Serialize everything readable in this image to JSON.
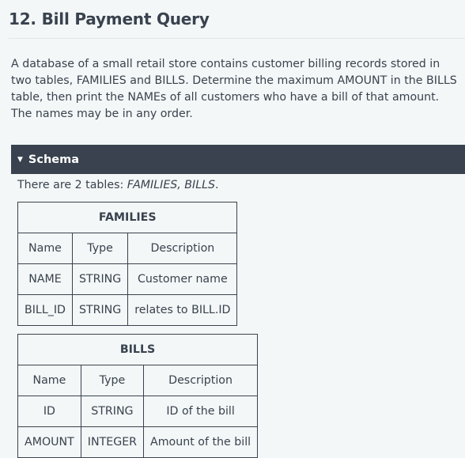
{
  "page": {
    "title": "12. Bill Payment Query",
    "description": "A database of a small retail store contains customer billing records stored in two tables, FAMILIES and BILLS. Determine the maximum AMOUNT in the BILLS table, then print the NAMEs of all customers who have a bill of that amount. The names may be in any order."
  },
  "schema": {
    "toggle_icon": "triangle-down-icon",
    "label": "Schema",
    "intro_prefix": "There are 2 tables: ",
    "intro_tables": "FAMILIES, BILLS",
    "intro_suffix": ".",
    "tables": [
      {
        "name": "FAMILIES",
        "headers": [
          "Name",
          "Type",
          "Description"
        ],
        "rows": [
          [
            "NAME",
            "STRING",
            "Customer name"
          ],
          [
            "BILL_ID",
            "STRING",
            "relates to BILL.ID"
          ]
        ]
      },
      {
        "name": "BILLS",
        "headers": [
          "Name",
          "Type",
          "Description"
        ],
        "rows": [
          [
            "ID",
            "STRING",
            "ID of the bill"
          ],
          [
            "AMOUNT",
            "INTEGER",
            "Amount of the bill"
          ]
        ]
      }
    ]
  },
  "colors": {
    "background": "#f3f7f7",
    "text": "#39424e",
    "schema_bar": "#39424e"
  }
}
